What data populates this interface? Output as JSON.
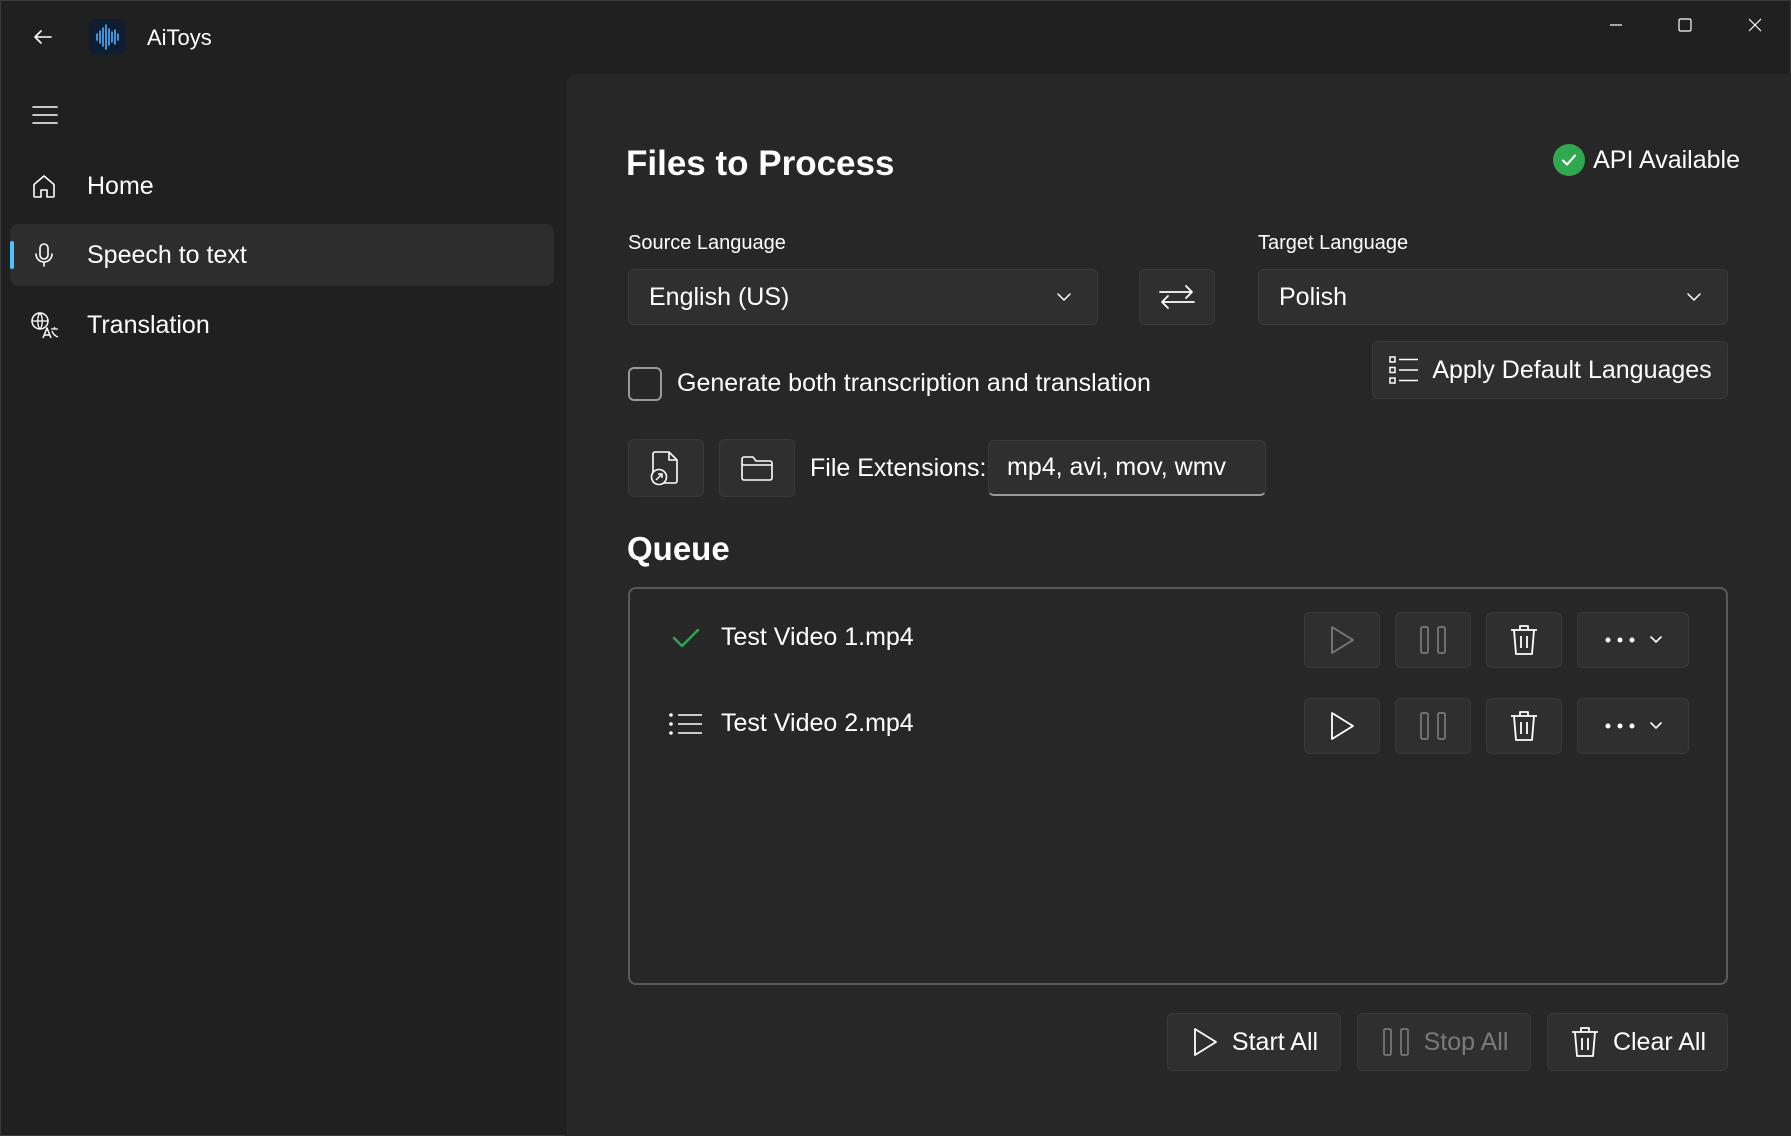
{
  "app": {
    "title": "AiToys"
  },
  "nav": {
    "items": [
      {
        "label": "Home",
        "icon": "home-icon"
      },
      {
        "label": "Speech to text",
        "icon": "microphone-icon",
        "active": true
      },
      {
        "label": "Translation",
        "icon": "translate-icon"
      }
    ]
  },
  "main": {
    "title": "Files to Process",
    "api_status": "API Available",
    "source_language": {
      "label": "Source Language",
      "value": "English (US)"
    },
    "target_language": {
      "label": "Target Language",
      "value": "Polish"
    },
    "generate_both": {
      "label": "Generate both transcription and translation",
      "checked": false
    },
    "apply_default_label": "Apply Default Languages",
    "file_extensions": {
      "label": "File Extensions:",
      "value": "mp4, avi, mov, wmv"
    },
    "queue_title": "Queue",
    "queue": [
      {
        "name": "Test Video 1.mp4",
        "status": "completed"
      },
      {
        "name": "Test Video 2.mp4",
        "status": "queued"
      }
    ],
    "actions": {
      "start_all": "Start All",
      "stop_all": "Stop All",
      "clear_all": "Clear All"
    }
  },
  "colors": {
    "accent": "#4cc2ff",
    "success": "#2fa84f",
    "background": "#202020",
    "panel": "#272727"
  }
}
